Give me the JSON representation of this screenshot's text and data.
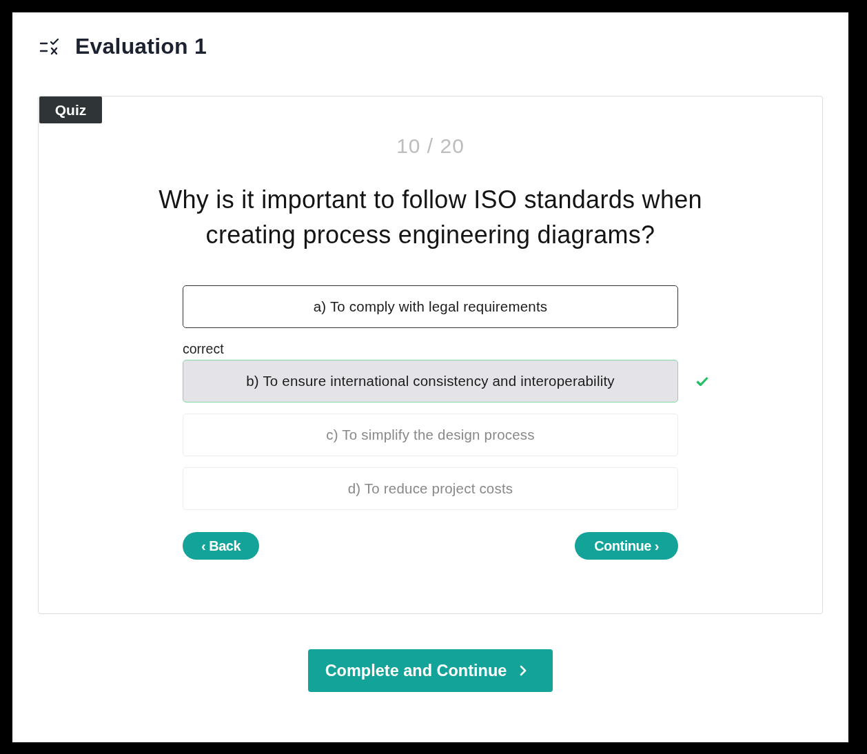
{
  "header": {
    "title": "Evaluation 1"
  },
  "quiz": {
    "badge": "Quiz",
    "progress": "10 / 20",
    "question": "Why is it important to follow ISO standards when creating process engineering diagrams?",
    "options": [
      {
        "label": "a) To comply with legal requirements",
        "hovered": true,
        "correct": false
      },
      {
        "status_label": "correct",
        "label": "b) To ensure international consistency and interoperability",
        "hovered": false,
        "correct": true
      },
      {
        "label": "c) To simplify the design process",
        "hovered": false,
        "correct": false
      },
      {
        "label": "d) To reduce project costs",
        "hovered": false,
        "correct": false
      }
    ],
    "buttons": [
      {
        "label": "‹ Back",
        "kind": "back"
      },
      {
        "label": "Continue ›",
        "kind": "next"
      }
    ]
  },
  "footer": {
    "button": "Complete and Continue"
  }
}
